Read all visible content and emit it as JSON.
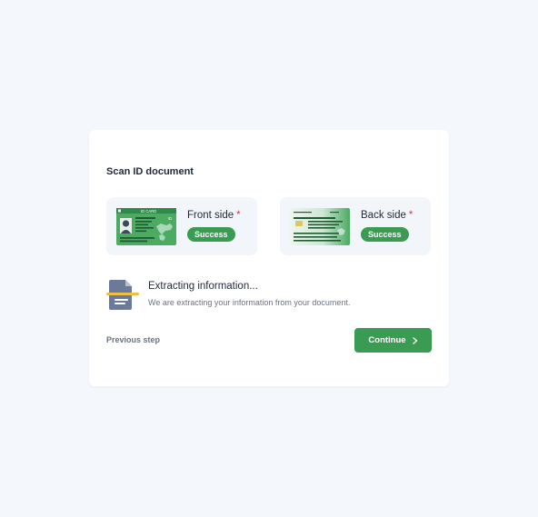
{
  "card": {
    "title": "Scan ID document"
  },
  "front": {
    "label": "Front side",
    "required_mark": "*",
    "status": "Success",
    "card_header_text": "ID CARD",
    "card_corner_text": "ID"
  },
  "back": {
    "label": "Back side",
    "required_mark": "*",
    "status": "Success"
  },
  "extract": {
    "title": "Extracting information...",
    "description": "We are extracting your information from your document.",
    "icon": "document-scan-icon"
  },
  "actions": {
    "previous_label": "Previous step",
    "continue_label": "Continue",
    "continue_icon": "chevron-right-icon"
  },
  "colors": {
    "background": "#f4f8fc",
    "accent_green": "#3a9b52",
    "required_red": "#d9383b",
    "scan_line_yellow": "#f0c045",
    "icon_slate": "#6b7a99"
  }
}
